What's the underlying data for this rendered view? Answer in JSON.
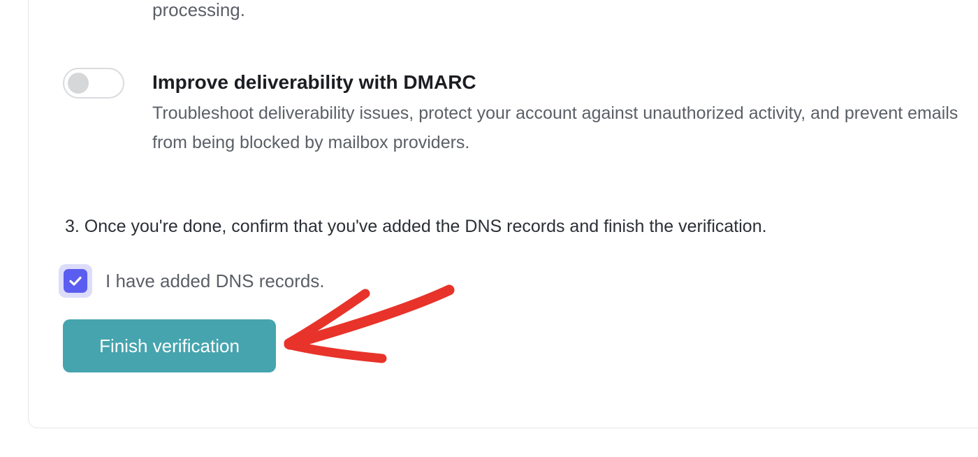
{
  "previous_option": {
    "description_tail": "processing."
  },
  "dmarc_option": {
    "enabled": false,
    "title": "Improve deliverability with DMARC",
    "description": "Troubleshoot deliverability issues, protect your account against unauthorized activity, and prevent emails from being blocked by mailbox providers."
  },
  "step3": {
    "text": "3. Once you're done, confirm that you've added the DNS records and finish the verification."
  },
  "dns_confirm": {
    "checked": true,
    "label": "I have added DNS records."
  },
  "finish_button": {
    "label": "Finish verification"
  },
  "colors": {
    "accent_button": "#46a4ae",
    "checkbox": "#5b5cf0",
    "annotation_arrow": "#e8332a"
  },
  "icons": {
    "checkmark": "check-icon",
    "annotation": "red-arrow-icon"
  }
}
